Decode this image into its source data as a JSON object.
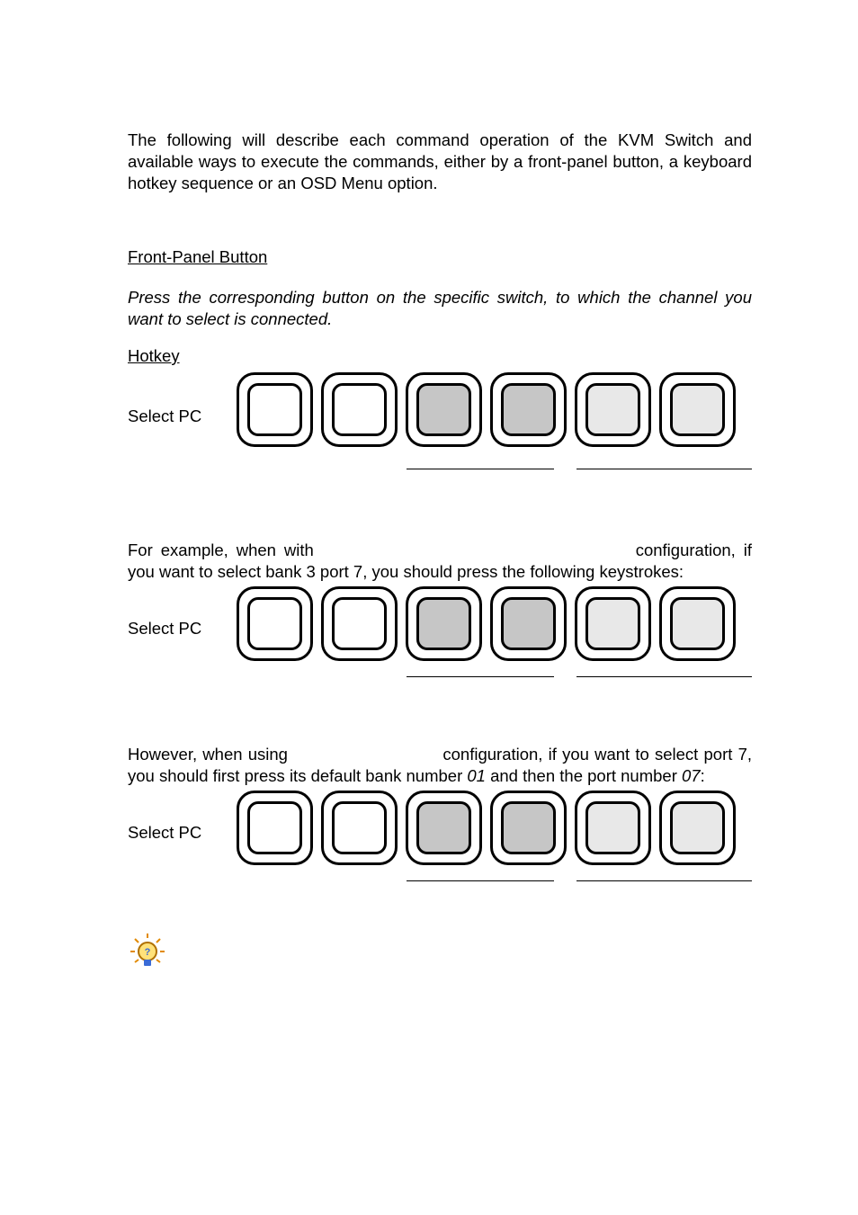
{
  "intro": "The following will describe each command operation of the KVM Switch and available ways to execute the commands, either by a front-panel button, a keyboard hotkey sequence or an OSD Menu option.",
  "front_panel_heading": "Front-Panel Button",
  "front_panel_text": "Press the corresponding button on the specific switch, to which the channel you want to select is connected.",
  "hotkey_heading": "Hotkey",
  "select_pc_label": "Select PC",
  "para2_part1": "For example, when with",
  "para2_part2": "configuration, if you want to select bank 3 port 7, you should press the following keystrokes:",
  "para3_part1": "However, when using",
  "para3_part2": "configuration, if you want to select port 7, you should first press its default bank number ",
  "para3_italic1": "01",
  "para3_part3": " and then the port number ",
  "para3_italic2": "07",
  "para3_part4": ":",
  "keys": {
    "row1": [
      "white",
      "white",
      "grey",
      "grey",
      "light",
      "light"
    ],
    "row2": [
      "white",
      "white",
      "grey",
      "grey",
      "light",
      "light"
    ],
    "row3": [
      "white",
      "white",
      "grey",
      "grey",
      "light",
      "light"
    ]
  }
}
